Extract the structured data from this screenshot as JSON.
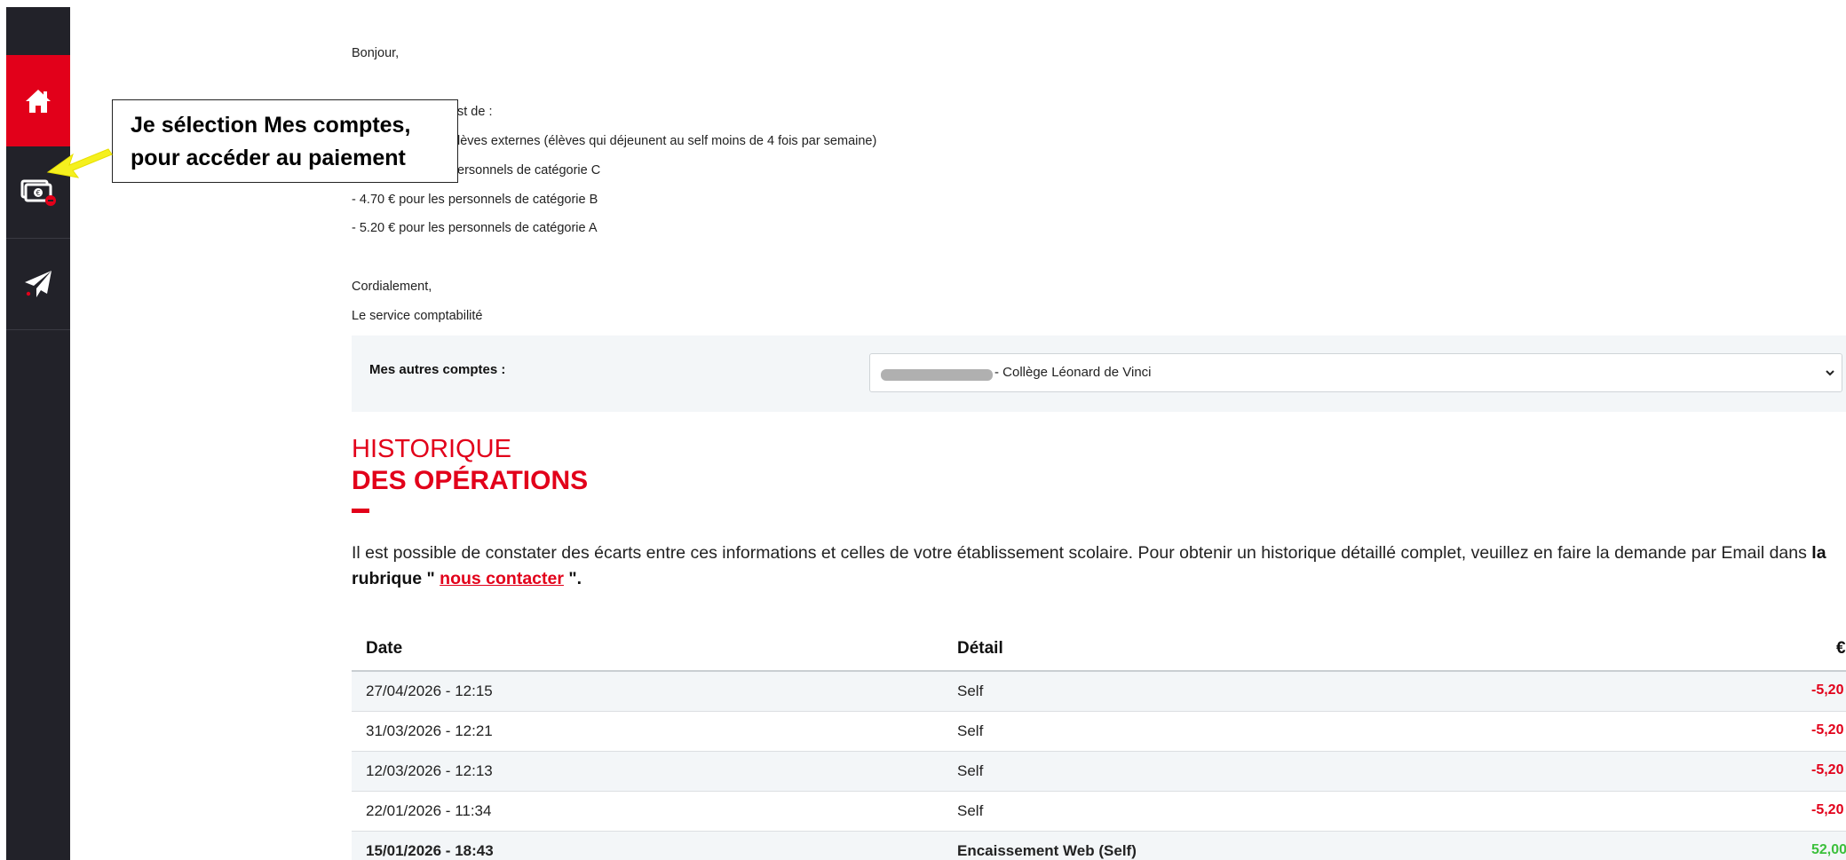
{
  "colors": {
    "accent": "#e2001a",
    "sidebar_bg": "#222229",
    "debit": "#e2001a",
    "credit": "#3cc03c",
    "callout_arrow": "#f5f01e"
  },
  "sidebar": {
    "items": [
      {
        "icon": "home-icon"
      },
      {
        "icon": "accounts-money-icon"
      },
      {
        "icon": "paper-plane-icon"
      }
    ]
  },
  "callout": {
    "line1": "Je sélection Mes comptes,",
    "line2": "pour accéder au paiement"
  },
  "message": {
    "greeting": "Bonjour,",
    "line_intro": "st de :",
    "line_externes": "lèves externes (élèves qui déjeunent au self moins de 4 fois par semaine)",
    "line_cat_c": "ersonnels de catégorie C",
    "line_cat_b": "- 4.70 € pour les personnels de catégorie B",
    "line_cat_a": "- 5.20 € pour les personnels de catégorie A",
    "closing": "Cordialement,",
    "signature": "Le service comptabilité"
  },
  "other_accounts": {
    "label": "Mes autres comptes :",
    "selected": "- Collège Léonard de Vinci"
  },
  "history": {
    "title_line1": "HISTORIQUE",
    "title_line2": "DES OPÉRATIONS",
    "info_text": "Il est possible de constater des écarts entre ces informations et celles de votre établissement scolaire. Pour obtenir un historique détaillé complet, veuillez en faire la demande par Email dans ",
    "info_strong_1": "la rubrique \" ",
    "info_link": "nous contacter",
    "info_strong_2": " \"."
  },
  "table": {
    "headers": {
      "date": "Date",
      "detail": "Détail",
      "amount": "€"
    },
    "rows": [
      {
        "date": "27/04/2026 - 12:15",
        "detail": "Self",
        "amount": "-5,20"
      },
      {
        "date": "31/03/2026 - 12:21",
        "detail": "Self",
        "amount": "-5,20"
      },
      {
        "date": "12/03/2026 - 12:13",
        "detail": "Self",
        "amount": "-5,20"
      },
      {
        "date": "22/01/2026 - 11:34",
        "detail": "Self",
        "amount": "-5,20"
      },
      {
        "date": "15/01/2026 - 18:43",
        "detail": "Encaissement Web (Self)",
        "amount": "52,00"
      }
    ]
  }
}
